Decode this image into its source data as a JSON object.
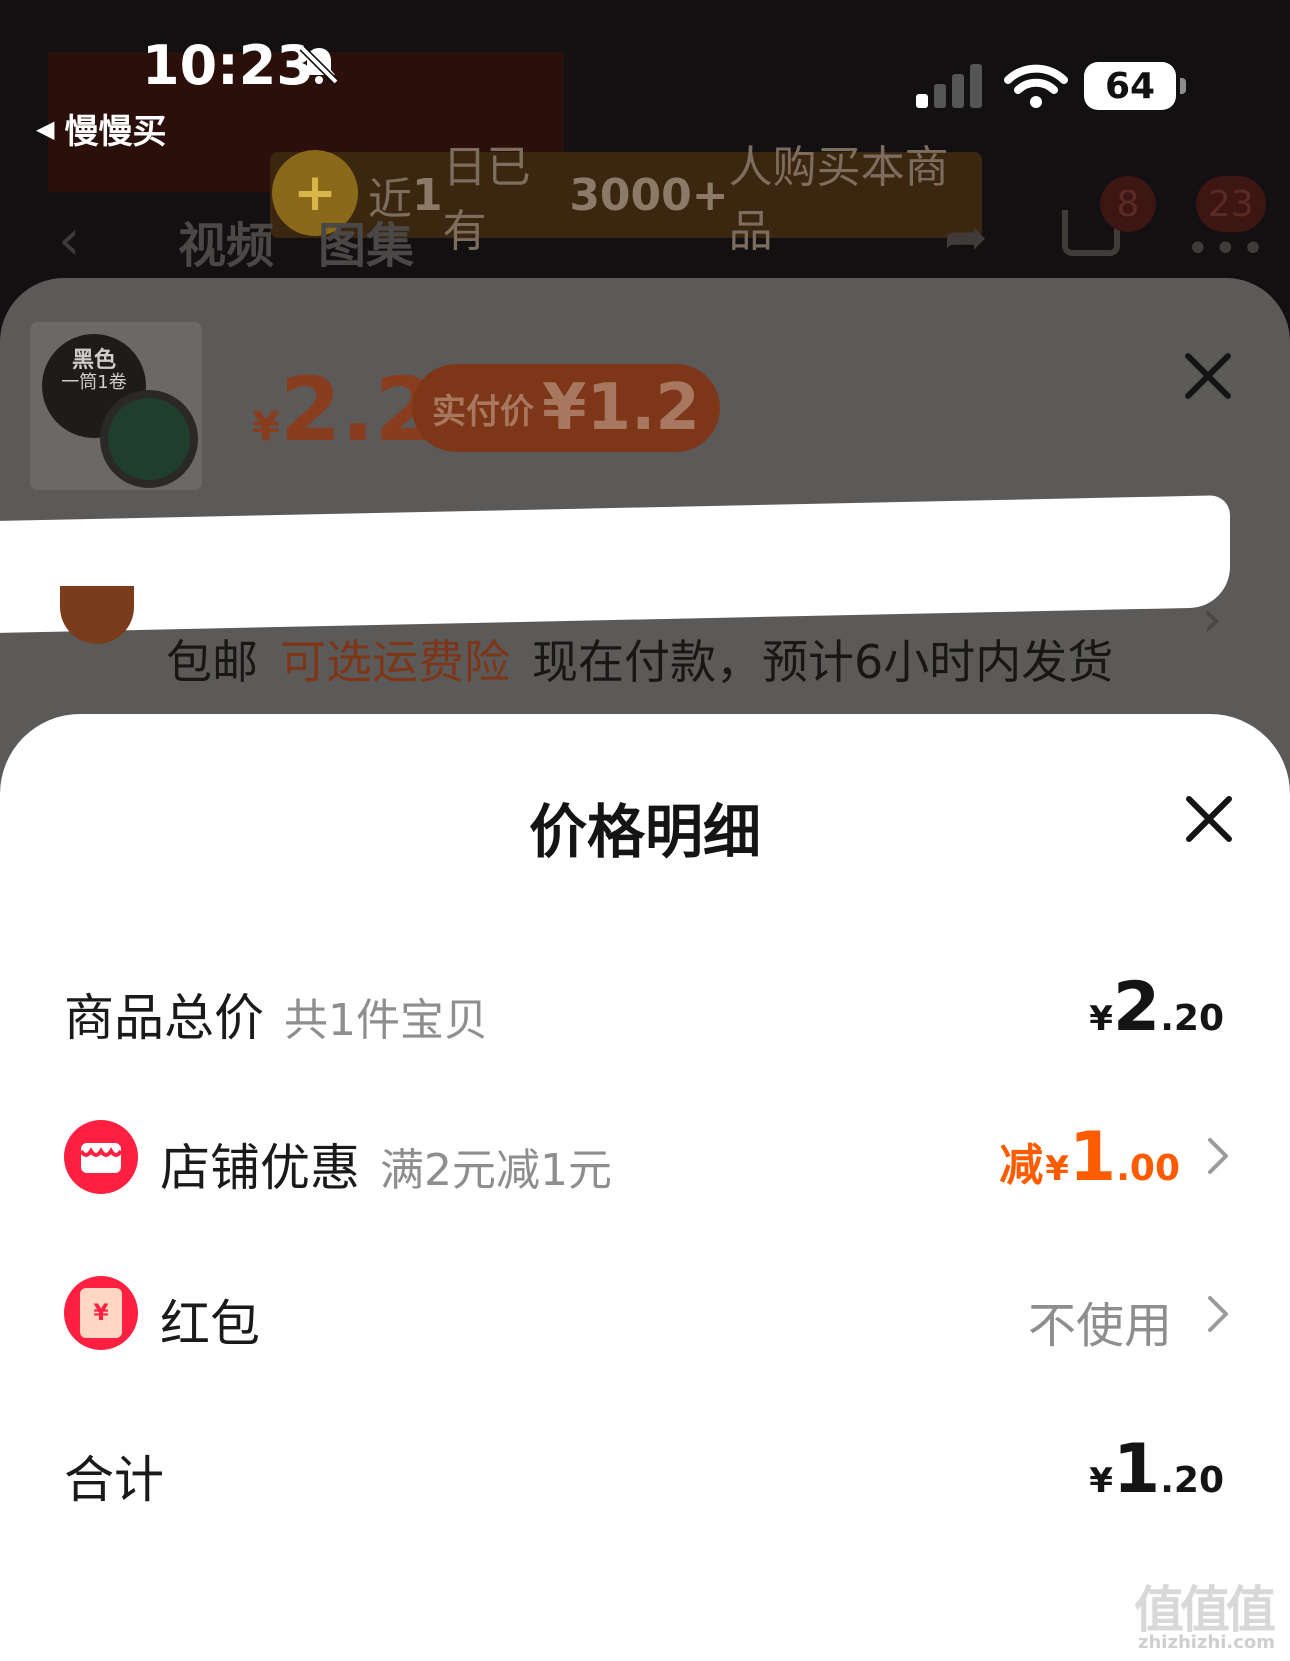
{
  "status_bar": {
    "time": "10:23",
    "back_app": "慢慢买",
    "battery": "64"
  },
  "background_page": {
    "promo_text_pre": "近",
    "promo_num1": "1",
    "promo_text_mid": "日已有",
    "promo_num2": "3000+",
    "promo_text_post": "人购买本商品",
    "tabs": [
      "视频",
      "图集"
    ],
    "cart_badge": "8",
    "more_badge": "23"
  },
  "sku_sheet": {
    "thumb_color_label": "黑色",
    "thumb_pack_label": "一筒1卷",
    "price_currency": "¥",
    "price": "2.2",
    "actual_price_label": "实付价",
    "actual_price": "¥1.2",
    "shipping_free": "包邮",
    "shipping_option": "可选运费险",
    "shipping_note": "现在付款，预计6小时内发货"
  },
  "price_detail": {
    "title": "价格明细",
    "items_total": {
      "label": "商品总价",
      "sub": "共1件宝贝",
      "currency": "¥",
      "int": "2",
      "dec": ".20"
    },
    "store_discount": {
      "label": "店铺优惠",
      "sub": "满2元减1元",
      "prefix": "减",
      "currency": "¥",
      "int": "1",
      "dec": ".00",
      "icon": "store-icon"
    },
    "red_packet": {
      "label": "红包",
      "value": "不使用",
      "icon": "red-packet-icon",
      "icon_glyph": "¥"
    },
    "total": {
      "label": "合计",
      "currency": "¥",
      "int": "1",
      "dec": ".20"
    }
  },
  "watermark": {
    "mark": "值值值",
    "url": "zhizhizhi.com"
  },
  "colors": {
    "accent_orange": "#ff5b00",
    "icon_red": "#ff1f41",
    "text_gray": "#8e8e8e"
  }
}
